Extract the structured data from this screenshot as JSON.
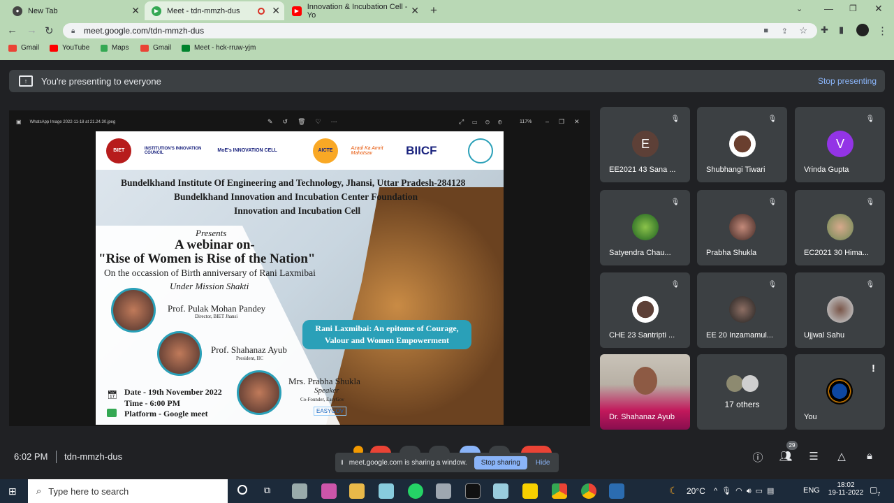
{
  "tabs": [
    {
      "title": "New Tab",
      "icon": "globe-icon"
    },
    {
      "title": "Meet - tdn-mmzh-dus",
      "icon": "meet-icon"
    },
    {
      "title": "Innovation & Incubation Cell - Yo",
      "icon": "youtube-icon"
    }
  ],
  "url": "meet.google.com/tdn-mmzh-dus",
  "bookmarks": [
    "Gmail",
    "YouTube",
    "Maps",
    "Gmail",
    "Meet - hck-rruw-yjm"
  ],
  "banner": {
    "text": "You're presenting to everyone",
    "stop": "Stop presenting"
  },
  "viewer": {
    "filename": "WhatsApp Image 2022-11-18 at 21.24.30.jpeg",
    "zoom": "117%"
  },
  "poster": {
    "logos": [
      "INSTITUTION'S INNOVATION COUNCIL",
      "MoE's INNOVATION CELL",
      "AICTE",
      "Azadi Ka Amrit Mahotsav",
      "BIICF"
    ],
    "line1": "Bundelkhand Institute Of Engineering and Technology, Jhansi, Uttar Pradesh-284128",
    "line2": "Bundelkhand Innovation and Incubation Center Foundation",
    "line3": "Innovation and Incubation Cell",
    "presents": "Presents",
    "webinar": "A webinar on-",
    "topic": "\"Rise of Women is Rise of the Nation\"",
    "occasion": "On the occassion of Birth anniversary of Rani Laxmibai",
    "mission": "Under Mission Shakti",
    "speaker1": "Prof. Pulak Mohan Pandey",
    "speaker1_role": "Director, BIET Jhansi",
    "speaker2": "Prof. Shahanaz Ayub",
    "speaker2_role": "President, IIC",
    "speaker3": "Mrs. Prabha Shukla",
    "speaker3_role": "Speaker",
    "speaker3_org": "Co-Founder, EasyGov",
    "date": "Date - 19th November 2022",
    "time": "Time - 6:00 PM",
    "platform": "Platform - Google meet",
    "callout": "Rani Laxmibai: An epitome of Courage, Valour and Women Empowerment",
    "easygov": "EASYGOV"
  },
  "participants": [
    {
      "name": "EE2021 43 Sana ...",
      "initial": "E",
      "color": "#5d4037"
    },
    {
      "name": "Shubhangi Tiwari",
      "initial": "",
      "color": "#e8eaed"
    },
    {
      "name": "Vrinda Gupta",
      "initial": "V",
      "color": "#9334e6"
    },
    {
      "name": "Satyendra Chau...",
      "initial": "",
      "color": "#2e7d32"
    },
    {
      "name": "Prabha Shukla",
      "initial": "",
      "color": "#6d4c41"
    },
    {
      "name": "EC2021 30 Hima...",
      "initial": "",
      "color": "#8d6e63"
    },
    {
      "name": "CHE 23 Santripti ...",
      "initial": "",
      "color": "#e8eaed"
    },
    {
      "name": "EE 20 Inzamamul...",
      "initial": "",
      "color": "#4e342e"
    },
    {
      "name": "Ujjwal Sahu",
      "initial": "",
      "color": "#b0bec5"
    },
    {
      "name": "Dr. Shahanaz Ayub",
      "initial": "",
      "color": "#d81b60"
    },
    {
      "name": "17 others",
      "initial": "",
      "color": "#3c4043"
    },
    {
      "name": "You",
      "initial": "",
      "color": "#1a237e"
    }
  ],
  "meeting": {
    "time": "6:02 PM",
    "code": "tdn-mmzh-dus",
    "people_count": "29"
  },
  "sharebar": {
    "text": "meet.google.com is sharing a window.",
    "stop": "Stop sharing",
    "hide": "Hide"
  },
  "taskbar": {
    "search": "Type here to search",
    "weather": "20°C",
    "lang": "ENG",
    "time": "18:02",
    "date": "19-11-2022",
    "notif": "7"
  }
}
